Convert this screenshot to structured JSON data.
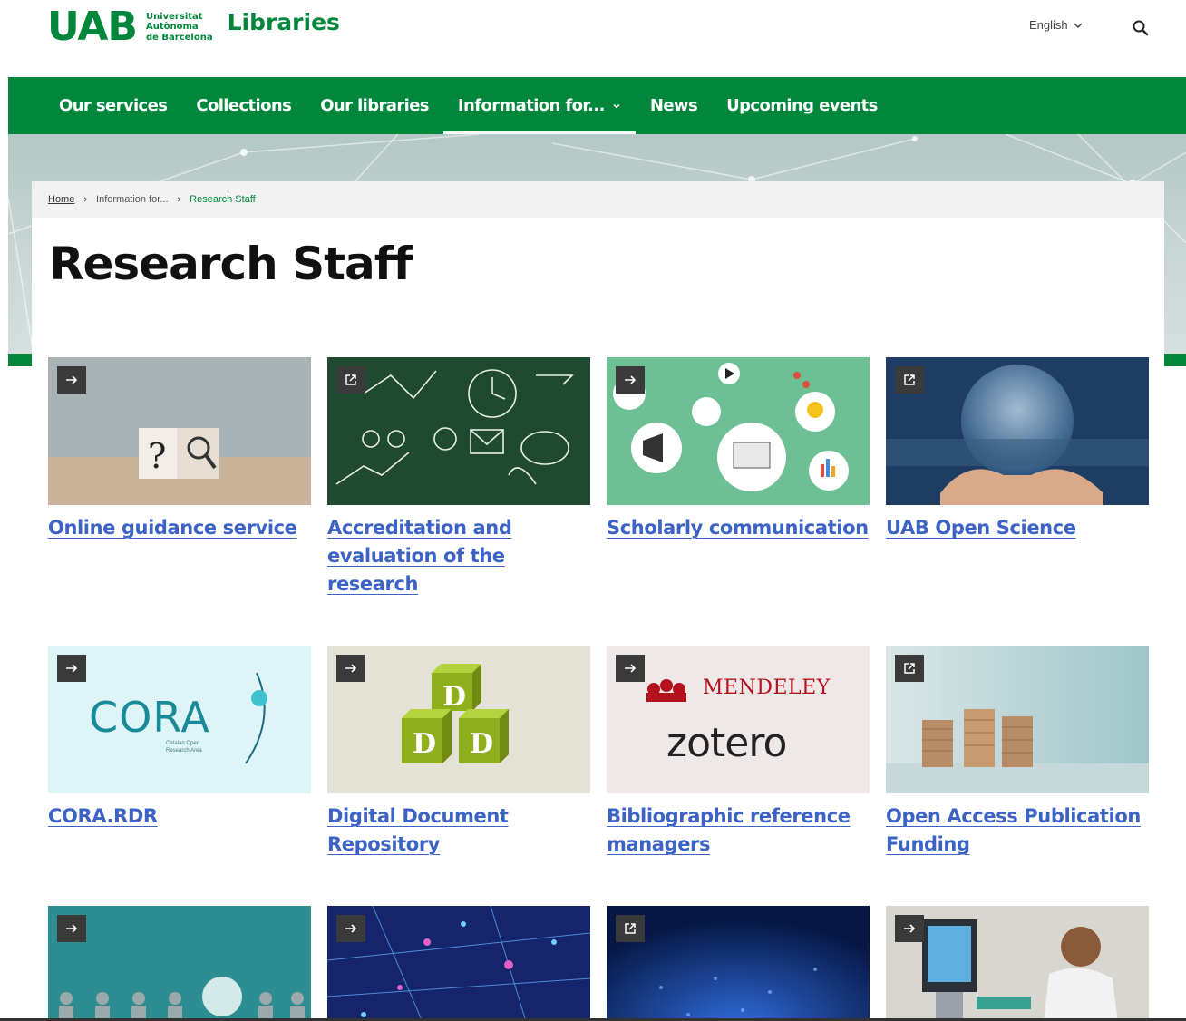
{
  "header": {
    "logo_text": "UAB",
    "logo_sub_line1": "Universitat",
    "logo_sub_line2": "Autònoma",
    "logo_sub_line3": "de Barcelona",
    "site_name": "Libraries",
    "language": "English",
    "search_icon": "search-icon"
  },
  "nav": {
    "items": [
      {
        "label": "Our services"
      },
      {
        "label": "Collections"
      },
      {
        "label": "Our libraries"
      },
      {
        "label": "Information for..."
      },
      {
        "label": "News"
      },
      {
        "label": "Upcoming events"
      }
    ],
    "active_index": 3
  },
  "breadcrumb": {
    "home": "Home",
    "middle": "Information for...",
    "current": "Research Staff"
  },
  "page": {
    "title": "Research Staff"
  },
  "tiles": [
    {
      "label": "Online guidance service",
      "badge": "arrow-right-icon"
    },
    {
      "label": "Accreditation and evaluation of the research",
      "badge": "external-link-icon"
    },
    {
      "label": "Scholarly communication",
      "badge": "arrow-right-icon"
    },
    {
      "label": "UAB Open Science",
      "badge": "external-link-icon"
    },
    {
      "label": "CORA.RDR",
      "badge": "arrow-right-icon",
      "image_text": "CORA",
      "image_sub": "Catalan Open Research Area"
    },
    {
      "label": "Digital Document Repository",
      "badge": "arrow-right-icon",
      "image_text": "D"
    },
    {
      "label": "Bibliographic reference managers",
      "badge": "arrow-right-icon",
      "image_text_1": "MENDELEY",
      "image_text_2": "zotero"
    },
    {
      "label": "Open Access Publication Funding",
      "badge": "external-link-icon"
    },
    {
      "label": "",
      "badge": "arrow-right-icon"
    },
    {
      "label": "",
      "badge": "arrow-right-icon"
    },
    {
      "label": "",
      "badge": "external-link-icon"
    },
    {
      "label": "",
      "badge": "arrow-right-icon"
    }
  ],
  "colors": {
    "brand_green": "#00873c",
    "link_blue": "#3c63c4"
  }
}
